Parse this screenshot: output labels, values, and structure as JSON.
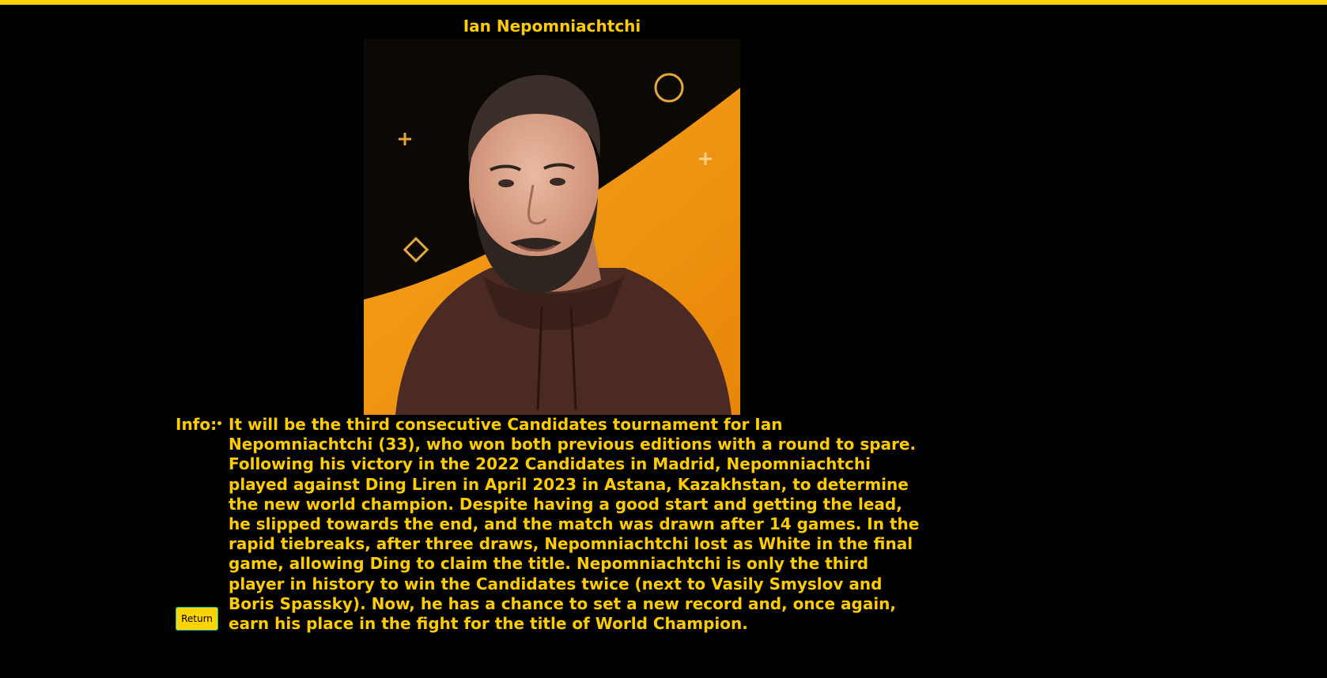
{
  "colors": {
    "accent": "#FFD000",
    "background": "#000000",
    "text": "#FFCC00",
    "button_border": "#00C2A8"
  },
  "player": {
    "name": "Ian Nepomniachtchi"
  },
  "info": {
    "label": "Info:",
    "items": [
      "It will be the third consecutive Candidates tournament for Ian Nepomniachtchi (33), who won both previous editions with a round to spare. Following his victory in the 2022 Candidates in Madrid, Nepomniachtchi played against Ding Liren in April 2023 in Astana, Kazakhstan, to determine the new world champion. Despite having a good start and getting the lead, he slipped towards the end, and the match was drawn after 14 games. In the rapid tiebreaks, after three draws, Nepomniachtchi lost as White in the final game, allowing Ding to claim the title. Nepomniachtchi is only the third player in history to win the Candidates twice (next to Vasily Smyslov and Boris Spassky). Now, he has a chance to set a new record and, once again, earn his place in the fight for the title of World Champion."
    ]
  },
  "actions": {
    "return_label": "Return"
  }
}
